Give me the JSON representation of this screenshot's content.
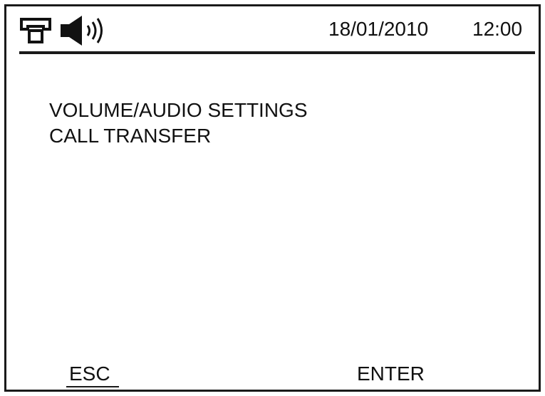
{
  "status_bar": {
    "icons": [
      "phone-icon",
      "speaker-icon"
    ],
    "date": "18/01/2010",
    "time": "12:00"
  },
  "menu": {
    "items": [
      {
        "label": "VOLUME/AUDIO SETTINGS"
      },
      {
        "label": "CALL TRANSFER"
      }
    ]
  },
  "softkeys": {
    "left": "ESC",
    "right": "ENTER"
  },
  "colors": {
    "foreground": "#111111",
    "background": "#ffffff"
  }
}
